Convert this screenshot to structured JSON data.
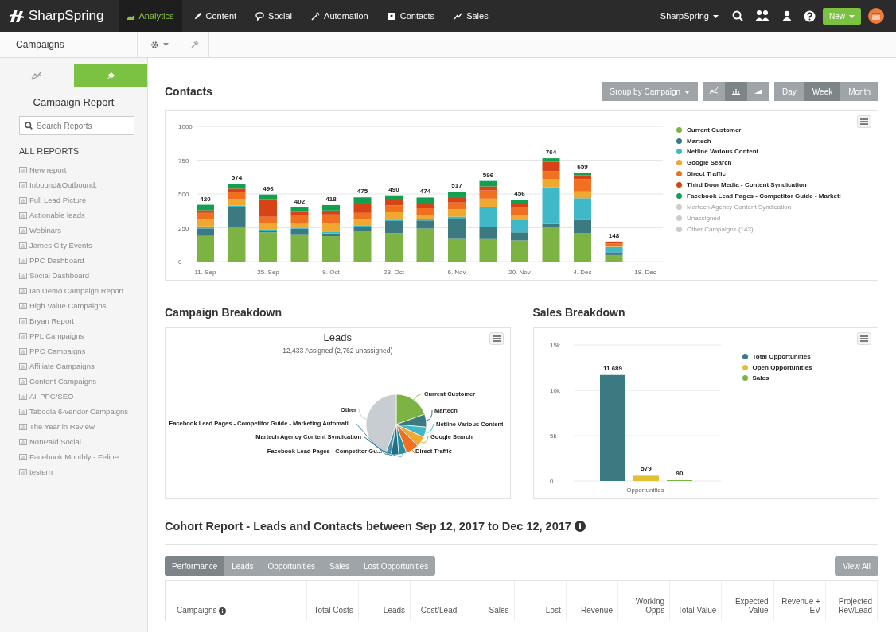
{
  "nav": {
    "logo": "SharpSpring",
    "items": [
      {
        "label": "Analytics",
        "kind": "chart",
        "selected": true
      },
      {
        "label": "Content",
        "kind": "pencil",
        "selected": false
      },
      {
        "label": "Social",
        "kind": "chat",
        "selected": false
      },
      {
        "label": "Automation",
        "kind": "wand",
        "selected": false
      },
      {
        "label": "Contacts",
        "kind": "card",
        "selected": false
      },
      {
        "label": "Sales",
        "kind": "trend",
        "selected": false
      }
    ]
  },
  "account": {
    "name": "SharpSpring",
    "new_button": "New"
  },
  "subbar": {
    "title": "Campaigns"
  },
  "sidebar": {
    "tabs": [
      {
        "kind": "chart",
        "selected": false
      },
      {
        "kind": "pin",
        "selected": true
      }
    ],
    "title": "Campaign Report",
    "search": {
      "placeholder": "Search Reports"
    },
    "section": "ALL REPORTS",
    "reports": [
      "New report",
      "Inbound&Outbound;",
      "Full Lead Picture",
      "Actionable leads",
      "Webinars",
      "James City Events",
      "PPC Dashboard",
      "Social Dashboard",
      "Ian Demo Campaign Report",
      "High Value Campaigns",
      "Bryan Report",
      "PPL Campaigns",
      "PPC Campaigns",
      "Affiliate Campaigns",
      "Content Campaigns",
      "All PPC/SEO",
      "Taboola 6-vendor Campaigns",
      "The Year in Review",
      "NonPaid Social",
      "Facebook Monthly - Felipe",
      "testerrr"
    ]
  },
  "contacts": {
    "title": "Contacts",
    "group_by": "Group by Campaign",
    "chart_type_buttons": [
      {
        "kind": "line",
        "selected": false
      },
      {
        "kind": "bar",
        "selected": true
      },
      {
        "kind": "area",
        "selected": false
      }
    ],
    "period_buttons": [
      {
        "label": "Day",
        "selected": false
      },
      {
        "label": "Week",
        "selected": true
      },
      {
        "label": "Month",
        "selected": false
      }
    ],
    "chart_data": {
      "type": "bar",
      "stacked": true,
      "grid": true,
      "categories": [
        "11. Sep",
        null,
        "25. Sep",
        null,
        "9. Oct",
        null,
        "23. Oct",
        null,
        "6. Nov",
        null,
        "20. Nov",
        null,
        "4. Dec",
        null,
        "18. Dec"
      ],
      "value_labels": [
        "420",
        "574",
        "496",
        "402",
        "418",
        "475",
        "490",
        "474",
        "517",
        "596",
        "456",
        "764",
        "659",
        "148",
        null
      ],
      "ylim": [
        0,
        1000
      ],
      "yticks": [
        0,
        250,
        500,
        750,
        1000
      ],
      "series": [
        {
          "name": "Current Customer",
          "color": "#7cb342",
          "values": [
            190,
            259,
            216,
            202,
            188,
            225,
            210,
            244,
            167,
            166,
            156,
            254,
            209,
            48,
            null
          ]
        },
        {
          "name": "Martech",
          "color": "#3a7a80",
          "values": [
            55,
            145,
            10,
            40,
            20,
            30,
            90,
            60,
            150,
            90,
            60,
            25,
            100,
            20,
            null
          ]
        },
        {
          "name": "Netline Various Content",
          "color": "#3fb8c8",
          "values": [
            15,
            10,
            10,
            5,
            10,
            10,
            10,
            10,
            15,
            150,
            90,
            270,
            160,
            40,
            null
          ]
        },
        {
          "name": "Google Search",
          "color": "#f0a830",
          "values": [
            50,
            50,
            45,
            40,
            70,
            45,
            55,
            30,
            55,
            60,
            40,
            60,
            50,
            5,
            null
          ]
        },
        {
          "name": "Direct Traffic",
          "color": "#f07020",
          "values": [
            50,
            50,
            50,
            50,
            60,
            50,
            50,
            50,
            50,
            60,
            50,
            60,
            90,
            20,
            null
          ]
        },
        {
          "name": "Third Door Media - Content Syndication",
          "color": "#d84315",
          "values": [
            20,
            25,
            130,
            30,
            30,
            75,
            40,
            30,
            40,
            30,
            30,
            70,
            30,
            10,
            null
          ]
        },
        {
          "name": "Facebook Lead Pages - Competitor Guide - Marketi",
          "color": "#10a050",
          "values": [
            40,
            35,
            35,
            35,
            40,
            40,
            35,
            50,
            40,
            40,
            30,
            25,
            20,
            5,
            null
          ]
        }
      ]
    },
    "hidden_legend": [
      "Martech Agency Content Syndication",
      "Unassigned",
      "Other Campaigns (143)"
    ]
  },
  "campaign_breakdown": {
    "title": "Campaign Breakdown",
    "chart_title": "Leads",
    "subtitle": "12,433 Assigned (2,762 unassigned)",
    "slices": [
      {
        "label": "Current Customer",
        "color": "#7cb342"
      },
      {
        "label": "Other",
        "color": "#c8cdd2"
      },
      {
        "label": "Martech",
        "color": "#3a7a80"
      },
      {
        "label": "Facebook Lead Pages - Competitor Guide - Marketing Automati...",
        "color": "#4a90a4"
      },
      {
        "label": "Netline Various Content",
        "color": "#3fb8c8"
      },
      {
        "label": "Martech Agency Content Syndication",
        "color": "#1f6f8b"
      },
      {
        "label": "Google Search",
        "color": "#f0a830"
      },
      {
        "label": "Facebook Lead Pages - Competitor Gu...",
        "color": "#2a8f9d"
      },
      {
        "label": "Direct Traffic",
        "color": "#f07020"
      }
    ]
  },
  "sales_breakdown": {
    "title": "Sales Breakdown",
    "chart_data": {
      "type": "bar",
      "grid": true,
      "categories": [
        "Opportunities"
      ],
      "ylim": [
        0,
        15000
      ],
      "yticks": [
        {
          "value": 0,
          "label": "0"
        },
        {
          "value": 5000,
          "label": "5k"
        },
        {
          "value": 10000,
          "label": "10k"
        },
        {
          "value": 15000,
          "label": "15k"
        }
      ],
      "value_labels": [
        "11.689",
        "579",
        "90"
      ],
      "series": [
        {
          "name": "Total Opportunities",
          "color": "#3a7a80",
          "values": [
            11689
          ]
        },
        {
          "name": "Open Opportunities",
          "color": "#e2c033",
          "values": [
            579
          ]
        },
        {
          "name": "Sales",
          "color": "#7cb342",
          "values": [
            90
          ]
        }
      ]
    }
  },
  "cohort": {
    "title": "Cohort Report - Leads and Contacts between Sep 12, 2017 to Dec 12, 2017",
    "info": true,
    "tabs": [
      {
        "label": "Performance",
        "selected": true
      },
      {
        "label": "Leads",
        "selected": false
      },
      {
        "label": "Opportunities",
        "selected": false
      },
      {
        "label": "Sales",
        "selected": false
      },
      {
        "label": "Lost Opportunities",
        "selected": false
      }
    ],
    "view_all": "View All",
    "columns": [
      {
        "label": "Campaigns",
        "info": true
      },
      {
        "label": "Total Costs",
        "info": false
      },
      {
        "label": "Leads",
        "info": false
      },
      {
        "label": "Cost/Lead",
        "info": false
      },
      {
        "label": "Sales",
        "info": false
      },
      {
        "label": "Lost",
        "info": false
      },
      {
        "label": "Revenue",
        "info": false
      },
      {
        "label": "Working Opps",
        "info": false
      },
      {
        "label": "Total Value",
        "info": false
      },
      {
        "label": "Expected Value",
        "info": false
      },
      {
        "label": "Revenue + EV",
        "info": false
      },
      {
        "label": "Projected Rev/Lead",
        "info": false
      }
    ]
  }
}
